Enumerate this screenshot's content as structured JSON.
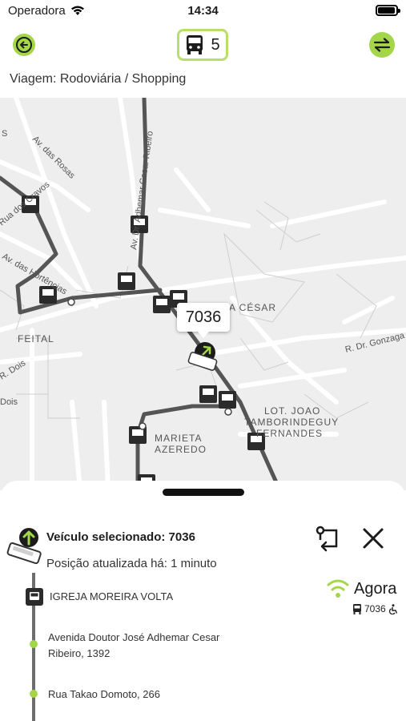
{
  "status": {
    "carrier": "Operadora",
    "time": "14:34"
  },
  "header": {
    "bus_count": "5",
    "trip_title": "Viagem: Rodoviária / Shopping"
  },
  "map": {
    "vehicle_bubble": "7036",
    "street_labels": [
      "Av. das Rosas",
      "Av. Dr. Adhemar Cesar Ribeiro",
      "Rua dos Cravos",
      "Av. das Hortências",
      "FEITAL",
      "A CÉSAR",
      "R. Dr. Gonzaga",
      "R. Dois",
      "Dois",
      "LOT. JOAO",
      "TAMBORINDEGUY",
      "FERNANDES",
      "MARIETA",
      "AZEREDO",
      "S"
    ]
  },
  "sheet": {
    "vehicle_title": "Veículo selecionado: 7036",
    "updated": "Posição atualizada há: 1 minuto",
    "now_label": "Agora",
    "now_vehicle": "7036",
    "stops": [
      "IGREJA MOREIRA VOLTA",
      "Avenida Doutor José Adhemar Cesar Ribeiro, 1392",
      "Rua Takao Domoto, 266"
    ]
  },
  "colors": {
    "accent": "#a4d64a",
    "route": "#555555",
    "map_bg": "#eeeeee"
  },
  "icons": [
    "wifi-icon",
    "back-arrow-icon",
    "bus-icon",
    "swap-icon",
    "bus-stop-icon",
    "route-icon",
    "close-icon",
    "signal-icon",
    "wheelchair-icon"
  ]
}
